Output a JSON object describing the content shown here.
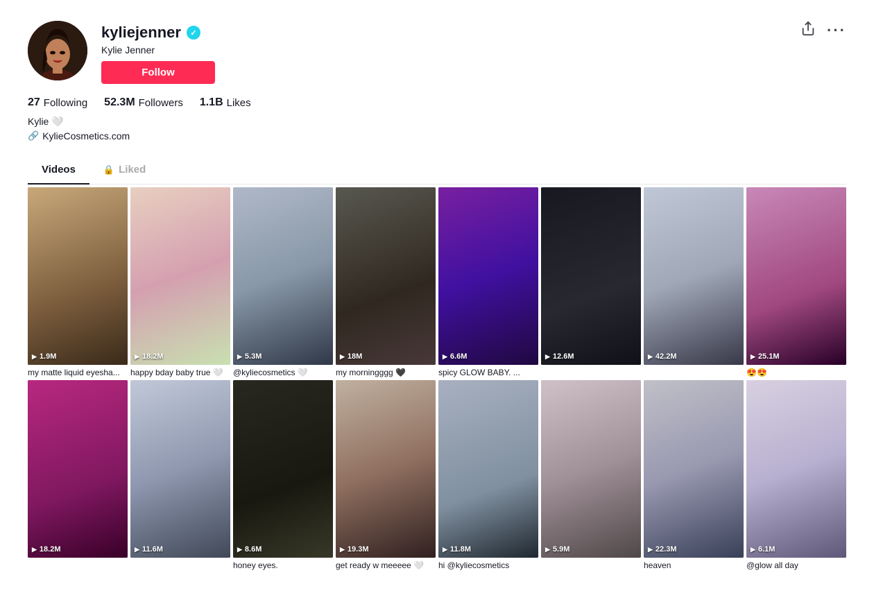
{
  "profile": {
    "username": "kyliejenner",
    "verified": true,
    "display_name": "Kylie Jenner",
    "follow_label": "Follow",
    "stats": {
      "following_count": "27",
      "following_label": "Following",
      "followers_count": "52.3M",
      "followers_label": "Followers",
      "likes_count": "1.1B",
      "likes_label": "Likes"
    },
    "bio": "Kylie 🤍",
    "website": "KylieCosmetics.com",
    "actions": {
      "share_icon": "↗",
      "more_icon": "···"
    }
  },
  "tabs": [
    {
      "id": "videos",
      "label": "Videos",
      "active": true,
      "locked": false
    },
    {
      "id": "liked",
      "label": "Liked",
      "active": false,
      "locked": true
    }
  ],
  "videos": [
    {
      "id": 1,
      "views": "1.9M",
      "caption": "my matte liquid eyesha...",
      "thumb_class": "thumb-1"
    },
    {
      "id": 2,
      "views": "18.2M",
      "caption": "happy bday baby true 🤍",
      "thumb_class": "thumb-2"
    },
    {
      "id": 3,
      "views": "5.3M",
      "caption": "@kyliecosmetics 🤍",
      "thumb_class": "thumb-3"
    },
    {
      "id": 4,
      "views": "18M",
      "caption": "my morningggg 🖤",
      "thumb_class": "thumb-4"
    },
    {
      "id": 5,
      "views": "6.6M",
      "caption": "spicy GLOW BABY. ...",
      "thumb_class": "thumb-5"
    },
    {
      "id": 6,
      "views": "12.6M",
      "caption": "",
      "thumb_class": "thumb-6"
    },
    {
      "id": 7,
      "views": "42.2M",
      "caption": "",
      "thumb_class": "thumb-7"
    },
    {
      "id": 8,
      "views": "25.1M",
      "caption": "😍😍",
      "thumb_class": "thumb-8"
    },
    {
      "id": 9,
      "views": "18.2M",
      "caption": "",
      "thumb_class": "thumb-9"
    },
    {
      "id": 10,
      "views": "11.6M",
      "caption": "",
      "thumb_class": "thumb-10"
    },
    {
      "id": 11,
      "views": "8.6M",
      "caption": "honey eyes.",
      "thumb_class": "thumb-11"
    },
    {
      "id": 12,
      "views": "19.3M",
      "caption": "get ready w meeeee 🤍",
      "thumb_class": "thumb-12"
    },
    {
      "id": 13,
      "views": "11.8M",
      "caption": "hi @kyliecosmetics",
      "thumb_class": "thumb-13"
    },
    {
      "id": 14,
      "views": "5.9M",
      "caption": "",
      "thumb_class": "thumb-14"
    },
    {
      "id": 15,
      "views": "22.3M",
      "caption": "heaven",
      "thumb_class": "thumb-15"
    },
    {
      "id": 16,
      "views": "6.1M",
      "caption": "@glow all day",
      "thumb_class": "thumb-16"
    }
  ]
}
